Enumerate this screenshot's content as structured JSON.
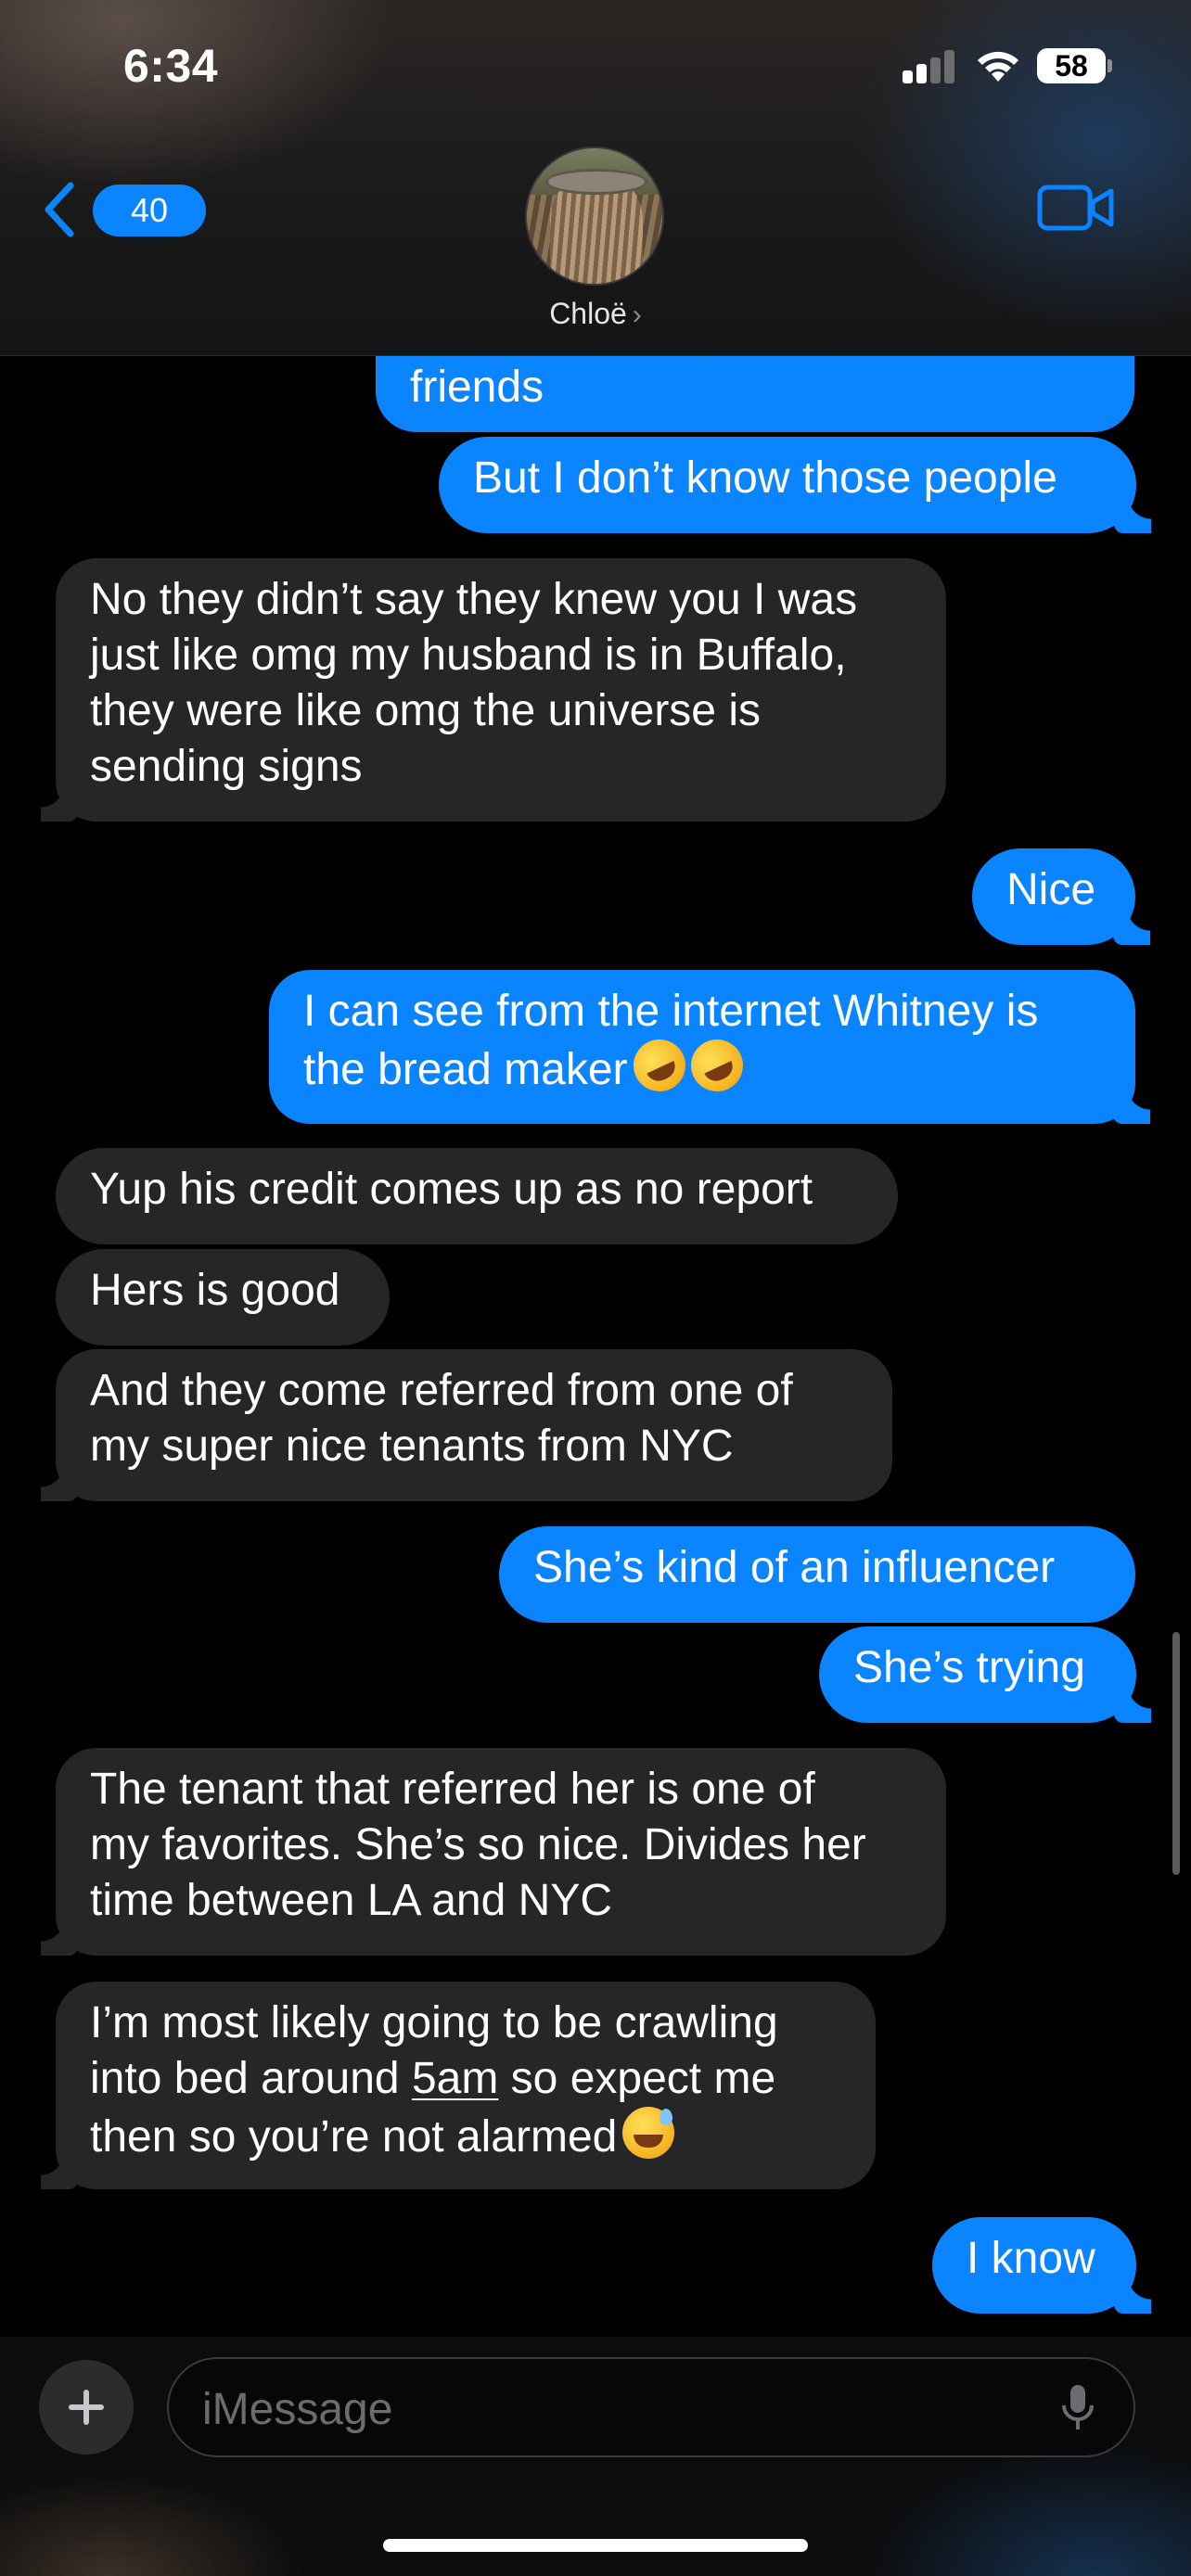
{
  "status_bar": {
    "time": "6:34",
    "battery": "58"
  },
  "header": {
    "back_count": "40",
    "contact_name": "Chloë",
    "contact_chevron": "›"
  },
  "messages": [
    {
      "direction": "sent",
      "text": "friends"
    },
    {
      "direction": "sent",
      "text": "But I don’t know those people"
    },
    {
      "direction": "received",
      "lines": [
        "No they didn’t say they knew you I was",
        "just like omg my husband is in Buffalo,",
        "they were like omg the universe is",
        "sending signs"
      ]
    },
    {
      "direction": "sent",
      "text": "Nice"
    },
    {
      "direction": "sent",
      "lines": [
        "I can see from the internet Whitney is",
        "the bread maker"
      ],
      "emoji": "rolling-on-floor-laughing ×2"
    },
    {
      "direction": "received",
      "text": "Yup his credit comes up as no report"
    },
    {
      "direction": "received",
      "text": "Hers is good"
    },
    {
      "direction": "received",
      "lines": [
        "And they come referred from one of",
        "my super nice tenants from NYC"
      ]
    },
    {
      "direction": "sent",
      "text": "She’s kind of an influencer"
    },
    {
      "direction": "sent",
      "text": "She’s trying"
    },
    {
      "direction": "received",
      "lines": [
        "The tenant that referred her is one of",
        "my favorites. She’s so nice. Divides her",
        "time between LA and NYC"
      ]
    },
    {
      "direction": "received",
      "lines": [
        "I’m most likely going to be crawling",
        "into bed around",
        "5am",
        "so expect me",
        "then so you’re not alarmed"
      ],
      "emoji": "grinning-sweat"
    },
    {
      "direction": "sent",
      "text": "I know"
    }
  ],
  "composer": {
    "placeholder": "iMessage"
  },
  "colors": {
    "sent_bubble": "#0a84ff",
    "received_bubble": "#262628",
    "background": "#000000"
  },
  "icons": [
    "back-chevron-icon",
    "video-camera-icon",
    "plus-icon",
    "microphone-icon",
    "cellular-signal-icon",
    "wifi-icon",
    "battery-icon"
  ]
}
